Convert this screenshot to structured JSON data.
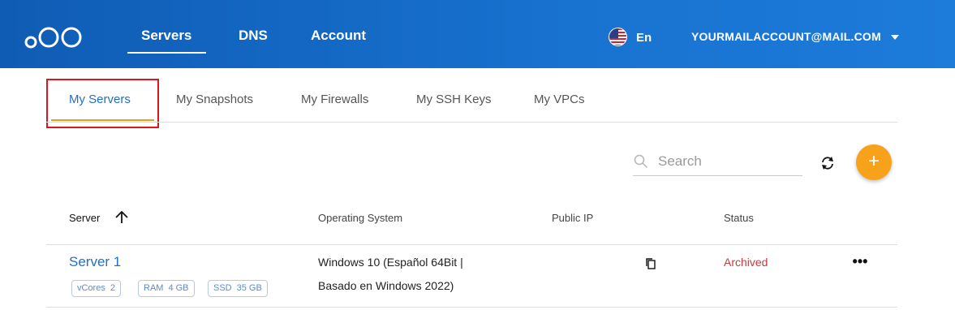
{
  "header": {
    "nav": [
      "Servers",
      "DNS",
      "Account"
    ],
    "active_nav": "Servers",
    "language": "En",
    "account_email": "YOURMAILACCOUNT@MAIL.COM"
  },
  "tabs": {
    "items": [
      "My Servers",
      "My Snapshots",
      "My Firewalls",
      "My SSH Keys",
      "My VPCs"
    ],
    "active": "My Servers"
  },
  "search": {
    "placeholder": "Search",
    "value": ""
  },
  "table": {
    "columns": [
      "Server",
      "Operating System",
      "Public IP",
      "Status"
    ],
    "sort_column": "Server",
    "sort_direction": "ascending",
    "rows": [
      {
        "name": "Server 1",
        "specs": [
          {
            "label": "vCores",
            "value": "2"
          },
          {
            "label": "RAM",
            "value": "4 GB"
          },
          {
            "label": "SSD",
            "value": "35 GB"
          }
        ],
        "os_line1": "Windows 10 (Español 64Bit |",
        "os_line2": "Basado en Windows 2022)",
        "public_ip": "",
        "status": "Archived"
      }
    ]
  },
  "icons": {
    "logo": "brand-logo-circles",
    "flag": "us-flag-icon",
    "account_menu": "chevron-down-icon",
    "search": "search-icon",
    "refresh": "refresh-icon",
    "add": "plus-icon",
    "sort": "arrow-up-icon",
    "copy": "copy-icon",
    "more": "more-horizontal-icon"
  },
  "colors": {
    "header_start": "#0f5cb4",
    "header_end": "#1d7bd9",
    "accent_orange": "#f7a21a",
    "link_blue": "#1e6fc8",
    "status_archived": "#c43c3c",
    "highlight_red": "#e0141b"
  }
}
